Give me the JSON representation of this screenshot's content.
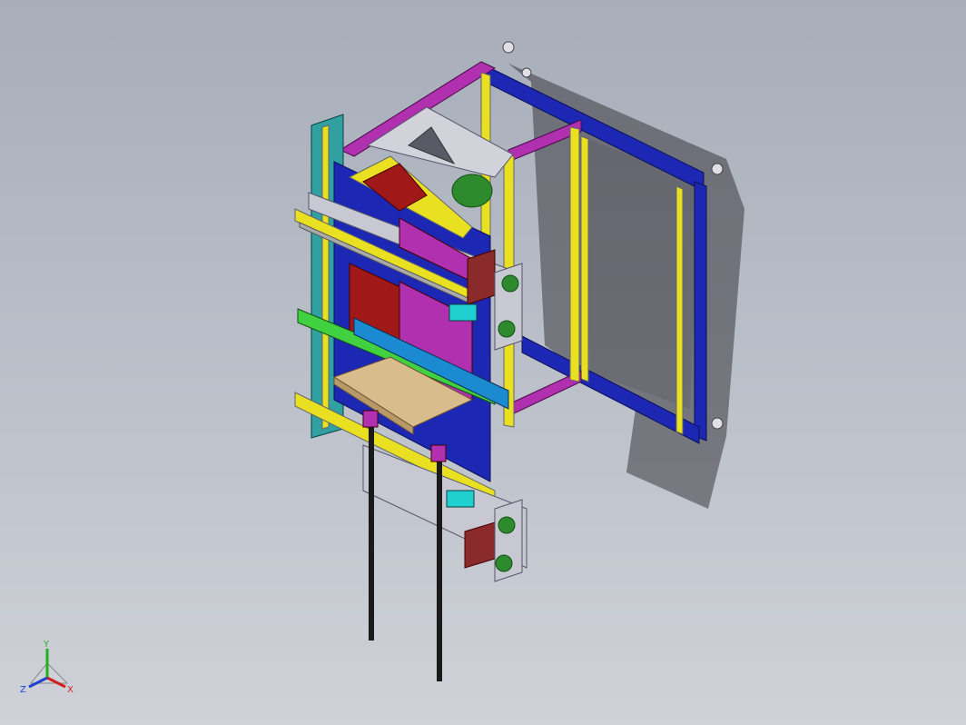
{
  "viewport": {
    "background_top": "#a7adb9",
    "background_bottom": "#cfd2d8"
  },
  "triad": {
    "x_label": "X",
    "y_label": "Y",
    "z_label": "Z",
    "x_color": "#d02020",
    "y_color": "#20b020",
    "z_color": "#2040d0"
  },
  "model": {
    "profile_colors": {
      "blue": "#1c28b4",
      "magenta": "#b030b0",
      "yellow": "#e8e020",
      "green": "#40d040",
      "teal": "#30a0a0",
      "red": "#a01818",
      "grey": "#b9b9c4",
      "wood": "#d8bc8c"
    }
  }
}
